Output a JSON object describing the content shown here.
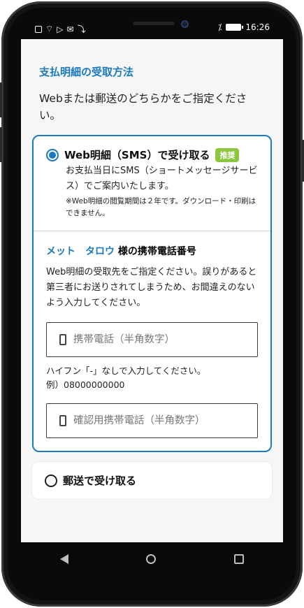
{
  "status_bar": {
    "time": "16:26",
    "icons": [
      "sim-icon",
      "wifi-icon",
      "cast-icon",
      "mail-icon",
      "mute-icon",
      "battery-icon"
    ]
  },
  "payment": {
    "section_title": "支払明細の受取方法",
    "description": "Webまたは郵送のどちらかをご指定ください。"
  },
  "option_web": {
    "title": "Web明細（SMS）で受け取る",
    "badge": "推奨",
    "description": "お支払当日にSMS（ショートメッセージサービス）でご案内いたします。",
    "note": "※Web明細の閲覧期間は２年です。ダウンロード・印刷はできません。"
  },
  "mobile": {
    "name": "メット　タロウ",
    "suffix": "様の携帯電話番号",
    "help": "Web明細の受取先をご指定ください。誤りがあると第三者にお送りされてしまうため、お間違えのないよう入力してください。",
    "phone_placeholder": "携帯電話（半角数字）",
    "hint_line1": "ハイフン「-」なしで入力してください。",
    "hint_line2": "例）08000000000",
    "confirm_placeholder": "確認用携帯電話（半角数字）"
  },
  "option_mail": {
    "title": "郵送で受け取る"
  },
  "colors": {
    "accent": "#1a7abf",
    "badge": "#8bc63f"
  }
}
